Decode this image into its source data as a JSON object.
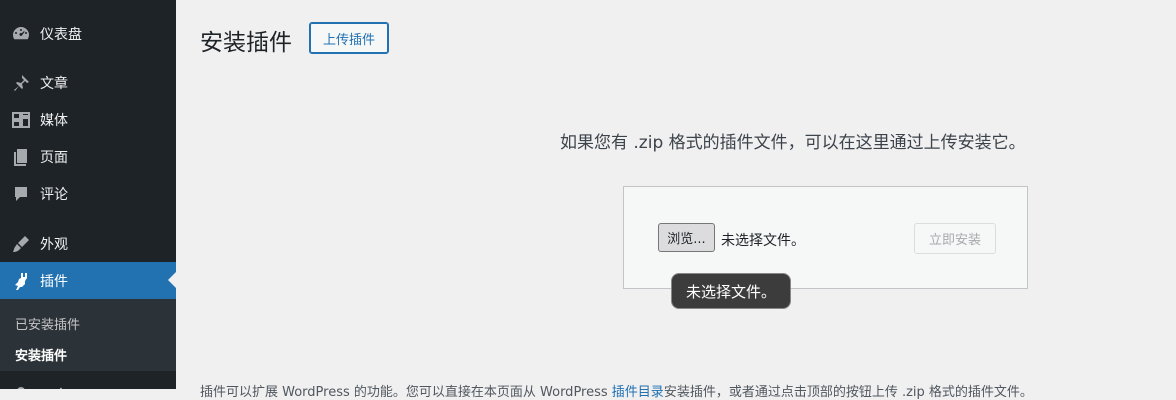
{
  "sidebar": {
    "items": [
      {
        "label": "仪表盘",
        "icon": "dashboard-icon"
      },
      {
        "label": "文章",
        "icon": "pin-icon"
      },
      {
        "label": "媒体",
        "icon": "media-icon"
      },
      {
        "label": "页面",
        "icon": "page-icon"
      },
      {
        "label": "评论",
        "icon": "comment-icon"
      },
      {
        "label": "外观",
        "icon": "appearance-brush-icon"
      },
      {
        "label": "插件",
        "icon": "plugins-icon",
        "current": true
      },
      {
        "label": "用户",
        "icon": "user-icon"
      }
    ],
    "submenu": [
      {
        "label": "已安装插件"
      },
      {
        "label": "安装插件",
        "active": true
      }
    ]
  },
  "page": {
    "title": "安装插件",
    "upload_toggle_label": "上传插件",
    "help_text": "如果您有 .zip 格式的插件文件，可以在这里通过上传安装它。",
    "upload_form": {
      "browse_label": "浏览...",
      "file_status": "未选择文件。",
      "install_label": "立即安装"
    },
    "tooltip": "未选择文件。",
    "footer": {
      "before": "插件可以扩展 WordPress 的功能。您可以直接在本页面从 WordPress ",
      "link": "插件目录",
      "after": "安装插件，或者通过点击顶部的按钮上传 .zip 格式的插件文件。"
    }
  },
  "colors": {
    "sidebar_bg": "#1d2327",
    "accent": "#2271b1",
    "content_bg": "#f0f0f1"
  }
}
